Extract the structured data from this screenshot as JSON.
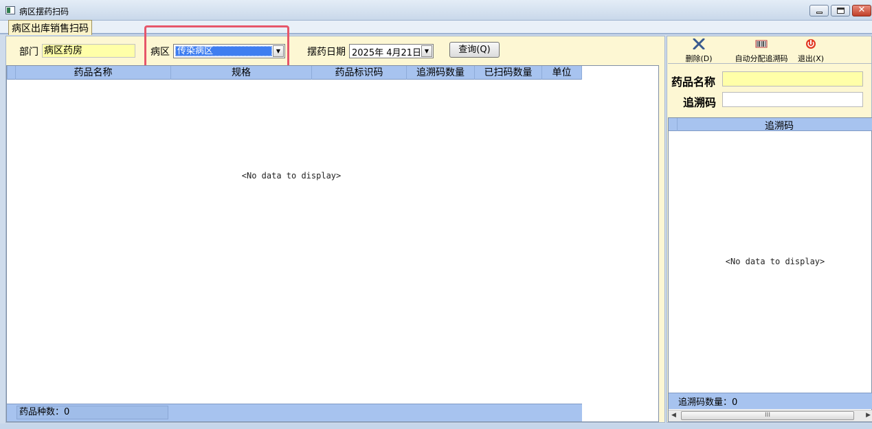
{
  "window": {
    "title": "病区摆药扫码",
    "close_glyph": "✕"
  },
  "tabs": [
    {
      "label": "病区出库销售扫码"
    }
  ],
  "filters": {
    "dept_label": "部门",
    "dept_value": "病区药房",
    "ward_label": "病区",
    "ward_value": "传染病区",
    "date_label": "摆药日期",
    "date_value": "2025年 4月21日",
    "query_button": "查询(Q)",
    "dropdown_glyph": "▼"
  },
  "grid": {
    "columns": [
      "药品名称",
      "规格",
      "药品标识码",
      "追溯码数量",
      "已扫码数量",
      "单位"
    ],
    "empty_text": "<No data to display>",
    "footer_drug_count": "药品种数：0"
  },
  "toolbar": {
    "delete": {
      "label": "删除(D)",
      "icon": "x-icon"
    },
    "auto_assign": {
      "label": "自动分配追溯码",
      "icon": "barcode-icon"
    },
    "exit": {
      "label": "退出(X)",
      "icon": "power-icon"
    }
  },
  "right_form": {
    "drug_name_label": "药品名称",
    "drug_name_value": "",
    "trace_code_label": "追溯码",
    "trace_code_value": ""
  },
  "right_grid": {
    "column": "追溯码",
    "empty_text": "<No data to display>",
    "footer_count": "追溯码数量：0",
    "scroll_left": "◀",
    "scroll_right": "▶",
    "scroll_grip": "III"
  },
  "colors": {
    "panel_bg": "#fdf7d3",
    "header_blue": "#a7c3ef",
    "highlight_red": "#e6566a",
    "input_yellow": "#ffffa8"
  }
}
